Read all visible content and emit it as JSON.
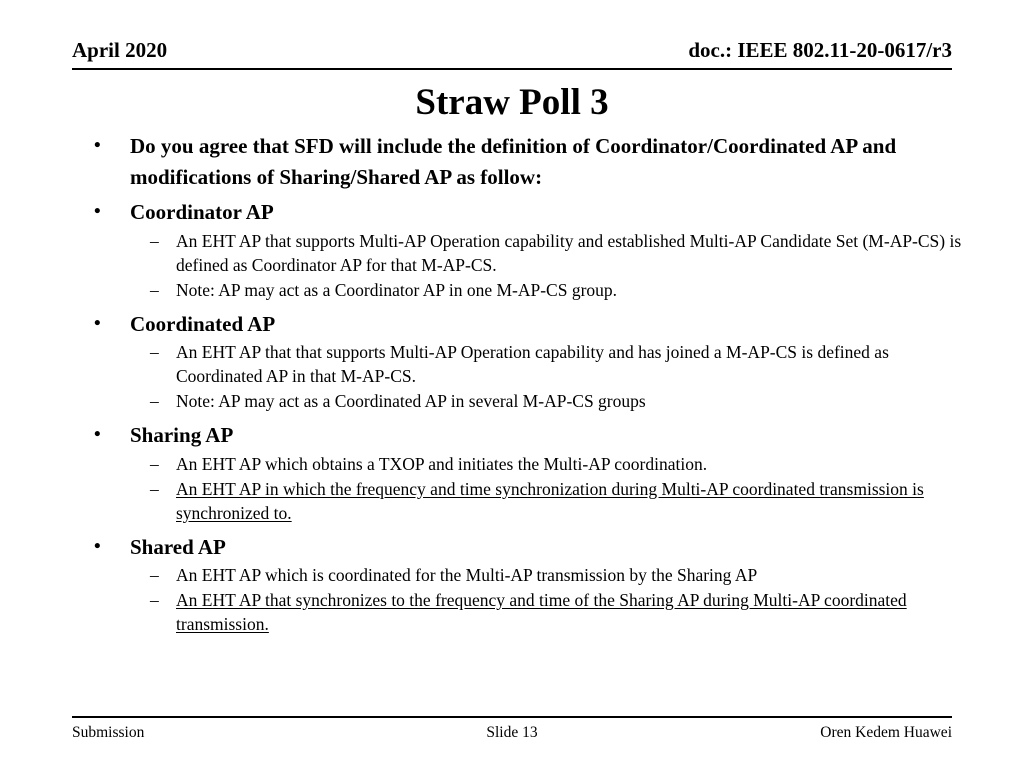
{
  "header": {
    "date": "April 2020",
    "doc": "doc.: IEEE 802.11-20-0617/r3"
  },
  "title": "Straw Poll 3",
  "markers": {
    "level1": "•",
    "level2": "–"
  },
  "body": {
    "intro": {
      "text": "Do you agree that SFD will include the definition of Coordinator/Coordinated AP and modifications of Sharing/Shared AP as follow:"
    },
    "sections": [
      {
        "heading": "Coordinator AP",
        "items": [
          {
            "text": "An EHT AP that supports Multi-AP Operation capability and established Multi-AP Candidate Set (M-AP-CS) is defined as Coordinator AP for that M-AP-CS.",
            "underlined": false
          },
          {
            "text": "Note: AP may act as a Coordinator AP in one M-AP-CS group.",
            "underlined": false
          }
        ]
      },
      {
        "heading": "Coordinated AP",
        "items": [
          {
            "text": "An EHT AP that that supports Multi-AP Operation capability and has joined a M-AP-CS is defined as Coordinated AP in that M-AP-CS.",
            "underlined": false
          },
          {
            "text": "Note: AP may act as a Coordinated AP in several M-AP-CS groups",
            "underlined": false
          }
        ]
      },
      {
        "heading": "Sharing AP",
        "items": [
          {
            "text": "An EHT AP which obtains a TXOP and initiates the Multi-AP coordination.",
            "underlined": false
          },
          {
            "text": "An EHT AP in which the frequency and time synchronization during Multi-AP coordinated transmission is synchronized to.",
            "underlined": true
          }
        ]
      },
      {
        "heading": "Shared AP",
        "items": [
          {
            "text": "An EHT AP which is coordinated for the Multi-AP transmission by the Sharing AP",
            "underlined": false
          },
          {
            "text": "An EHT AP that synchronizes to the frequency and time of the Sharing AP during Multi-AP coordinated transmission.",
            "underlined": true
          }
        ]
      }
    ]
  },
  "footer": {
    "left": "Submission",
    "center": "Slide 13",
    "right": "Oren Kedem Huawei"
  },
  "colors": {
    "text": "#000000",
    "background": "#ffffff",
    "rule": "#000000"
  }
}
